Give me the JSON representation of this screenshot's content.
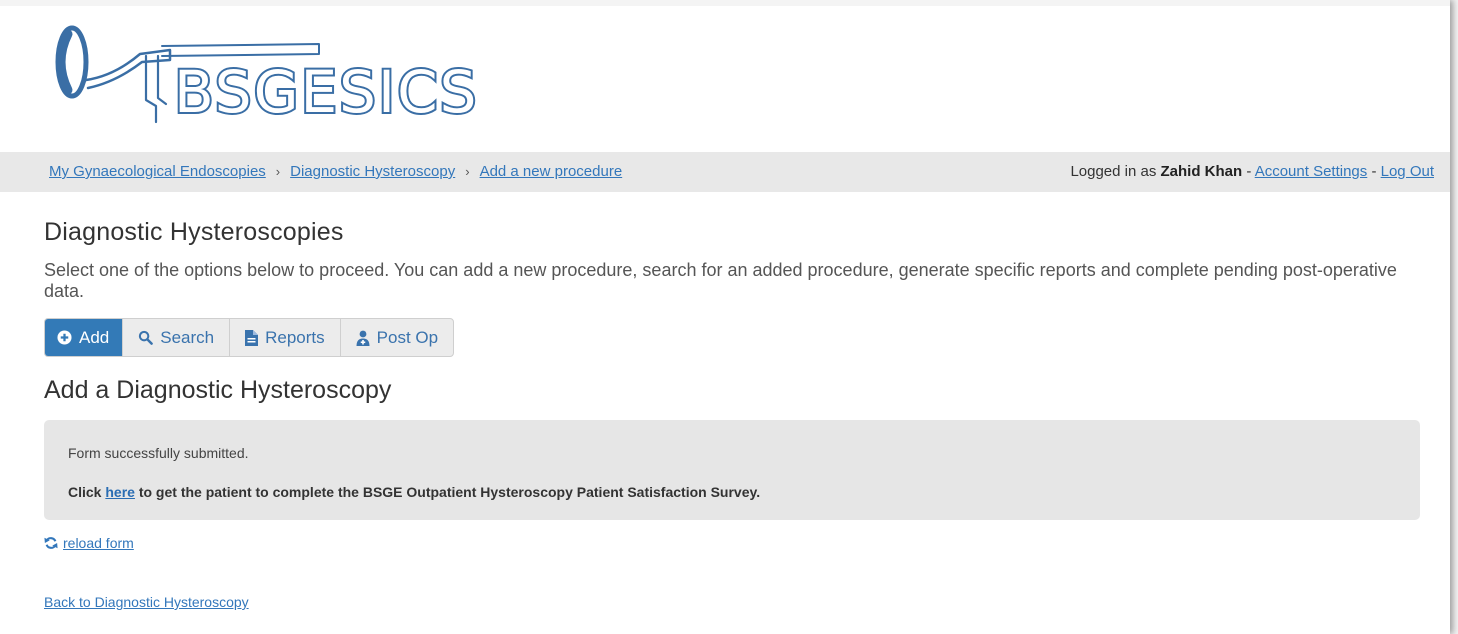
{
  "logo": {
    "text": "BSGESICS"
  },
  "breadcrumb": {
    "items": [
      "My Gynaecological Endoscopies",
      "Diagnostic Hysteroscopy",
      "Add a new procedure"
    ],
    "separator": "›"
  },
  "user": {
    "prefix": "Logged in as",
    "name": "Zahid Khan",
    "dash": "-",
    "account_settings": "Account Settings",
    "logout": "Log Out"
  },
  "page": {
    "title": "Diagnostic Hysteroscopies",
    "intro": "Select one of the options below to proceed. You can add a new procedure, search for an added procedure, generate specific reports and complete pending post-operative data.",
    "subtitle": "Add a Diagnostic Hysteroscopy"
  },
  "tabs": [
    {
      "label": "Add",
      "icon": "plus-circle-icon",
      "active": true
    },
    {
      "label": "Search",
      "icon": "search-icon",
      "active": false
    },
    {
      "label": "Reports",
      "icon": "document-icon",
      "active": false
    },
    {
      "label": "Post Op",
      "icon": "user-md-icon",
      "active": false
    }
  ],
  "alert": {
    "message": "Form successfully submitted.",
    "cta_prefix": "Click",
    "cta_link": "here",
    "cta_suffix": "to get the patient to complete the BSGE Outpatient Hysteroscopy Patient Satisfaction Survey."
  },
  "links": {
    "reload": "reload form",
    "back": "Back to Diagnostic Hysteroscopy"
  },
  "colors": {
    "primary": "#337ab7",
    "link": "#3377bb",
    "logo": "#3a6ea5",
    "alert_bg": "#e6e6e6",
    "breadcrumb_bg": "#e8e8e8"
  }
}
